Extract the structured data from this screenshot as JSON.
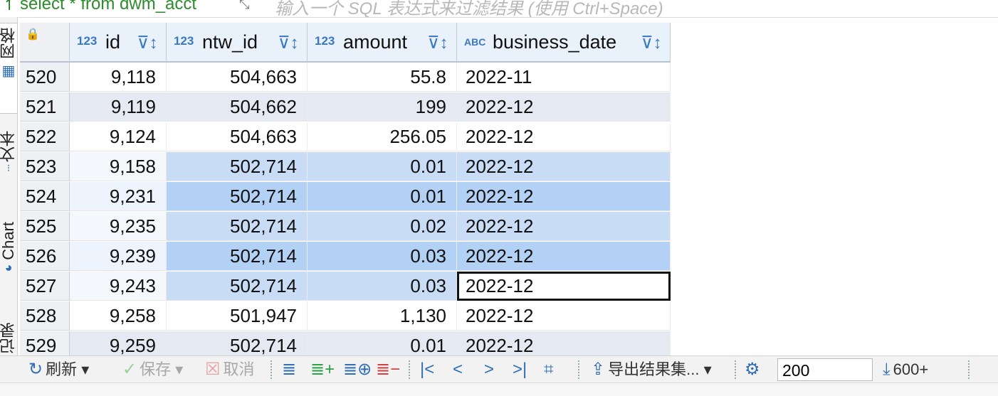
{
  "topbar": {
    "sql_text": "select * from dwm_acct",
    "filter_placeholder": "输入一个 SQL 表达式来过滤结果 (使用 Ctrl+Space)"
  },
  "side_tabs": [
    "网格",
    "文本",
    "Chart",
    "记录"
  ],
  "columns": [
    {
      "type": "123",
      "name": "id"
    },
    {
      "type": "123",
      "name": "ntw_id"
    },
    {
      "type": "123",
      "name": "amount"
    },
    {
      "type": "ABC",
      "name": "business_date"
    }
  ],
  "rows": [
    {
      "n": "520",
      "cells": [
        "9,118",
        "504,663",
        "55.8",
        "2022-11"
      ]
    },
    {
      "n": "521",
      "cells": [
        "9,119",
        "504,662",
        "199",
        "2022-12"
      ]
    },
    {
      "n": "522",
      "cells": [
        "9,124",
        "504,663",
        "256.05",
        "2022-12"
      ]
    },
    {
      "n": "523",
      "cells": [
        "9,158",
        "502,714",
        "0.01",
        "2022-12"
      ]
    },
    {
      "n": "524",
      "cells": [
        "9,231",
        "502,714",
        "0.01",
        "2022-12"
      ]
    },
    {
      "n": "525",
      "cells": [
        "9,235",
        "502,714",
        "0.02",
        "2022-12"
      ]
    },
    {
      "n": "526",
      "cells": [
        "9,239",
        "502,714",
        "0.03",
        "2022-12"
      ]
    },
    {
      "n": "527",
      "cells": [
        "9,243",
        "502,714",
        "0.03",
        "2022-12"
      ]
    },
    {
      "n": "528",
      "cells": [
        "9,258",
        "501,947",
        "1,130",
        "2022-12"
      ]
    },
    {
      "n": "529",
      "cells": [
        "9,259",
        "502,714",
        "0.01",
        "2022-12"
      ]
    }
  ],
  "toolbar": {
    "refresh": "刷新",
    "save": "保存",
    "cancel": "取消",
    "export": "导出结果集...",
    "fetch_size": "200",
    "count": "600+"
  },
  "colors": {
    "header_bg": "#e9f1fa",
    "row_alt": "#e4e9f2",
    "selection": "#c9dcf5",
    "selection_strong": "#b3d1f5",
    "accent": "#3a78c2"
  }
}
